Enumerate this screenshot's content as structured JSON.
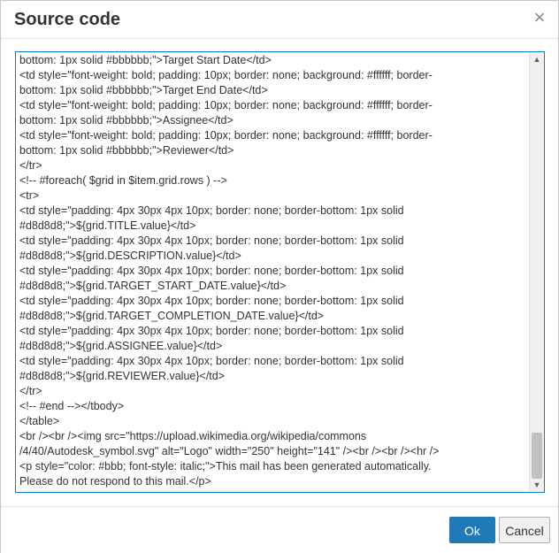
{
  "dialog": {
    "title": "Source code",
    "close_glyph": "×",
    "close_icon": "close-icon"
  },
  "editor": {
    "lines": [
      "bottom: 1px solid #bbbbbb;\">Target Start Date</td>",
      "<td style=\"font-weight: bold; padding: 10px; border: none; background: #ffffff; border-",
      "bottom: 1px solid #bbbbbb;\">Target End Date</td>",
      "<td style=\"font-weight: bold; padding: 10px; border: none; background: #ffffff; border-",
      "bottom: 1px solid #bbbbbb;\">Assignee</td>",
      "<td style=\"font-weight: bold; padding: 10px; border: none; background: #ffffff; border-",
      "bottom: 1px solid #bbbbbb;\">Reviewer</td>",
      "</tr>",
      "<!-- #foreach( $grid in $item.grid.rows ) -->",
      "<tr>",
      "<td style=\"padding: 4px 30px 4px 10px; border: none; border-bottom: 1px solid",
      "#d8d8d8;\">${grid.TITLE.value}</td>",
      "<td style=\"padding: 4px 30px 4px 10px; border: none; border-bottom: 1px solid",
      "#d8d8d8;\">${grid.DESCRIPTION.value}</td>",
      "<td style=\"padding: 4px 30px 4px 10px; border: none; border-bottom: 1px solid",
      "#d8d8d8;\">${grid.TARGET_START_DATE.value}</td>",
      "<td style=\"padding: 4px 30px 4px 10px; border: none; border-bottom: 1px solid",
      "#d8d8d8;\">${grid.TARGET_COMPLETION_DATE.value}</td>",
      "<td style=\"padding: 4px 30px 4px 10px; border: none; border-bottom: 1px solid",
      "#d8d8d8;\">${grid.ASSIGNEE.value}</td>",
      "<td style=\"padding: 4px 30px 4px 10px; border: none; border-bottom: 1px solid",
      "#d8d8d8;\">${grid.REVIEWER.value}</td>",
      "</tr>",
      "<!-- #end --></tbody>",
      "</table>",
      "<br /><br /><img src=\"https://upload.wikimedia.org/wikipedia/commons",
      "/4/40/Autodesk_symbol.svg\" alt=\"Logo\" width=\"250\" height=\"141\" /><br /><br /><hr />",
      "<p style=\"color: #bbb; font-style: italic;\">This mail has been generated automatically.",
      "Please do not respond to this mail.</p>"
    ],
    "scroll_up_glyph": "▲",
    "scroll_down_glyph": "▼"
  },
  "footer": {
    "ok_label": "Ok",
    "cancel_label": "Cancel"
  },
  "colors": {
    "ok_button_bg": "#207ab7",
    "editor_border": "#0b7dc2"
  }
}
